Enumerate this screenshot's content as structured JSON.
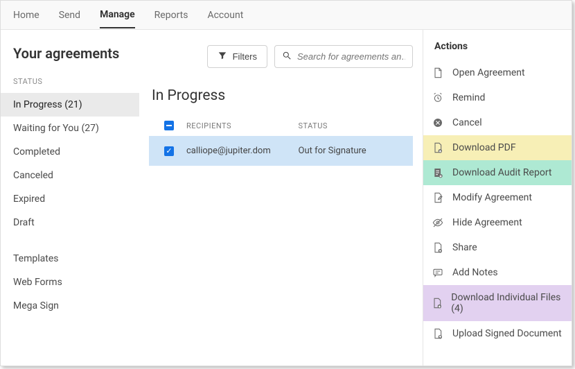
{
  "topnav": {
    "tabs": [
      "Home",
      "Send",
      "Manage",
      "Reports",
      "Account"
    ],
    "active": "Manage"
  },
  "left": {
    "heading": "Your agreements",
    "status_label": "STATUS",
    "items": [
      {
        "label": "In Progress (21)",
        "active": true
      },
      {
        "label": "Waiting for You (27)"
      },
      {
        "label": "Completed"
      },
      {
        "label": "Canceled"
      },
      {
        "label": "Expired"
      },
      {
        "label": "Draft"
      }
    ],
    "groups": [
      {
        "label": "Templates"
      },
      {
        "label": "Web Forms"
      },
      {
        "label": "Mega Sign"
      }
    ]
  },
  "toolbar": {
    "filters_label": "Filters",
    "search_placeholder": "Search for agreements an…"
  },
  "table": {
    "title": "In Progress",
    "columns": {
      "recipients": "RECIPIENTS",
      "status": "STATUS"
    },
    "rows": [
      {
        "recipients": "calliope@jupiter.dom",
        "status": "Out for Signature",
        "selected": true
      }
    ]
  },
  "actions": {
    "title": "Actions",
    "items": [
      {
        "label": "Open Agreement",
        "icon": "document-icon",
        "key": "open"
      },
      {
        "label": "Remind",
        "icon": "alarm-icon",
        "key": "remind"
      },
      {
        "label": "Cancel",
        "icon": "cancel-icon",
        "key": "cancel"
      },
      {
        "label": "Download PDF",
        "icon": "download-pdf-icon",
        "highlight": "yellow",
        "key": "download-pdf"
      },
      {
        "label": "Download Audit Report",
        "icon": "audit-report-icon",
        "highlight": "green",
        "key": "download-audit"
      },
      {
        "label": "Modify Agreement",
        "icon": "edit-document-icon",
        "key": "modify"
      },
      {
        "label": "Hide Agreement",
        "icon": "eye-off-icon",
        "key": "hide"
      },
      {
        "label": "Share",
        "icon": "share-icon",
        "key": "share"
      },
      {
        "label": "Add Notes",
        "icon": "notes-icon",
        "key": "add-notes"
      },
      {
        "label": "Download Individual Files (4)",
        "icon": "download-files-icon",
        "highlight": "purple",
        "key": "download-files"
      },
      {
        "label": "Upload Signed Document",
        "icon": "upload-document-icon",
        "key": "upload-signed"
      }
    ]
  }
}
